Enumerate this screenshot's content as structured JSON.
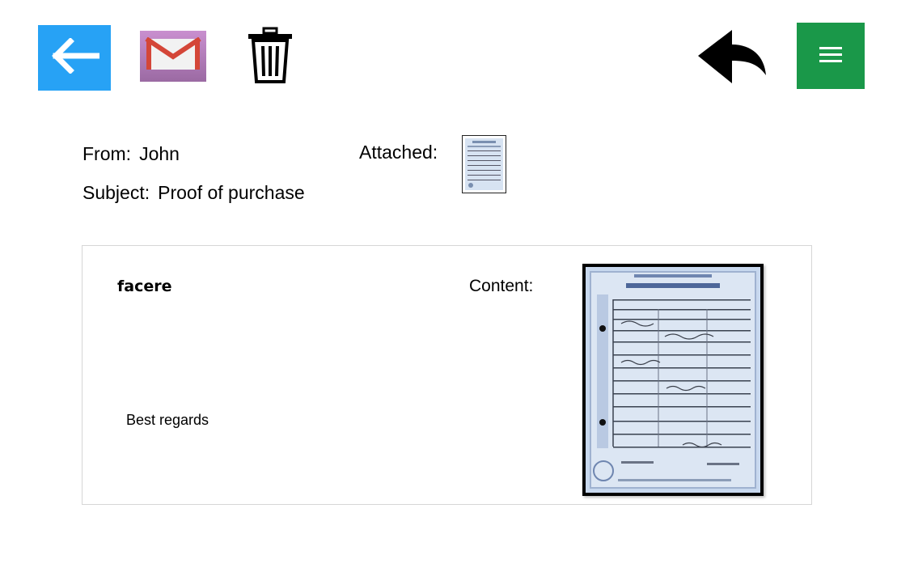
{
  "toolbar": {
    "back_icon": "arrow-left-icon",
    "mail_icon": "gmail-icon",
    "trash_icon": "trash-icon",
    "reply_icon": "reply-icon",
    "menu_icon": "hamburger-menu-icon",
    "colors": {
      "back": "#27a2f5",
      "menu": "#1a9849",
      "mail_red": "#d44638"
    }
  },
  "message": {
    "from_label": "From:",
    "from_value": "John",
    "subject_label": "Subject:",
    "subject_value": "Proof of purchase",
    "attached_label": "Attached:",
    "attachment_icon": "document-thumbnail-icon",
    "body_title": "facere",
    "signoff": "Best regards",
    "content_label": "Content:",
    "content_image": "certificate-document-image"
  }
}
